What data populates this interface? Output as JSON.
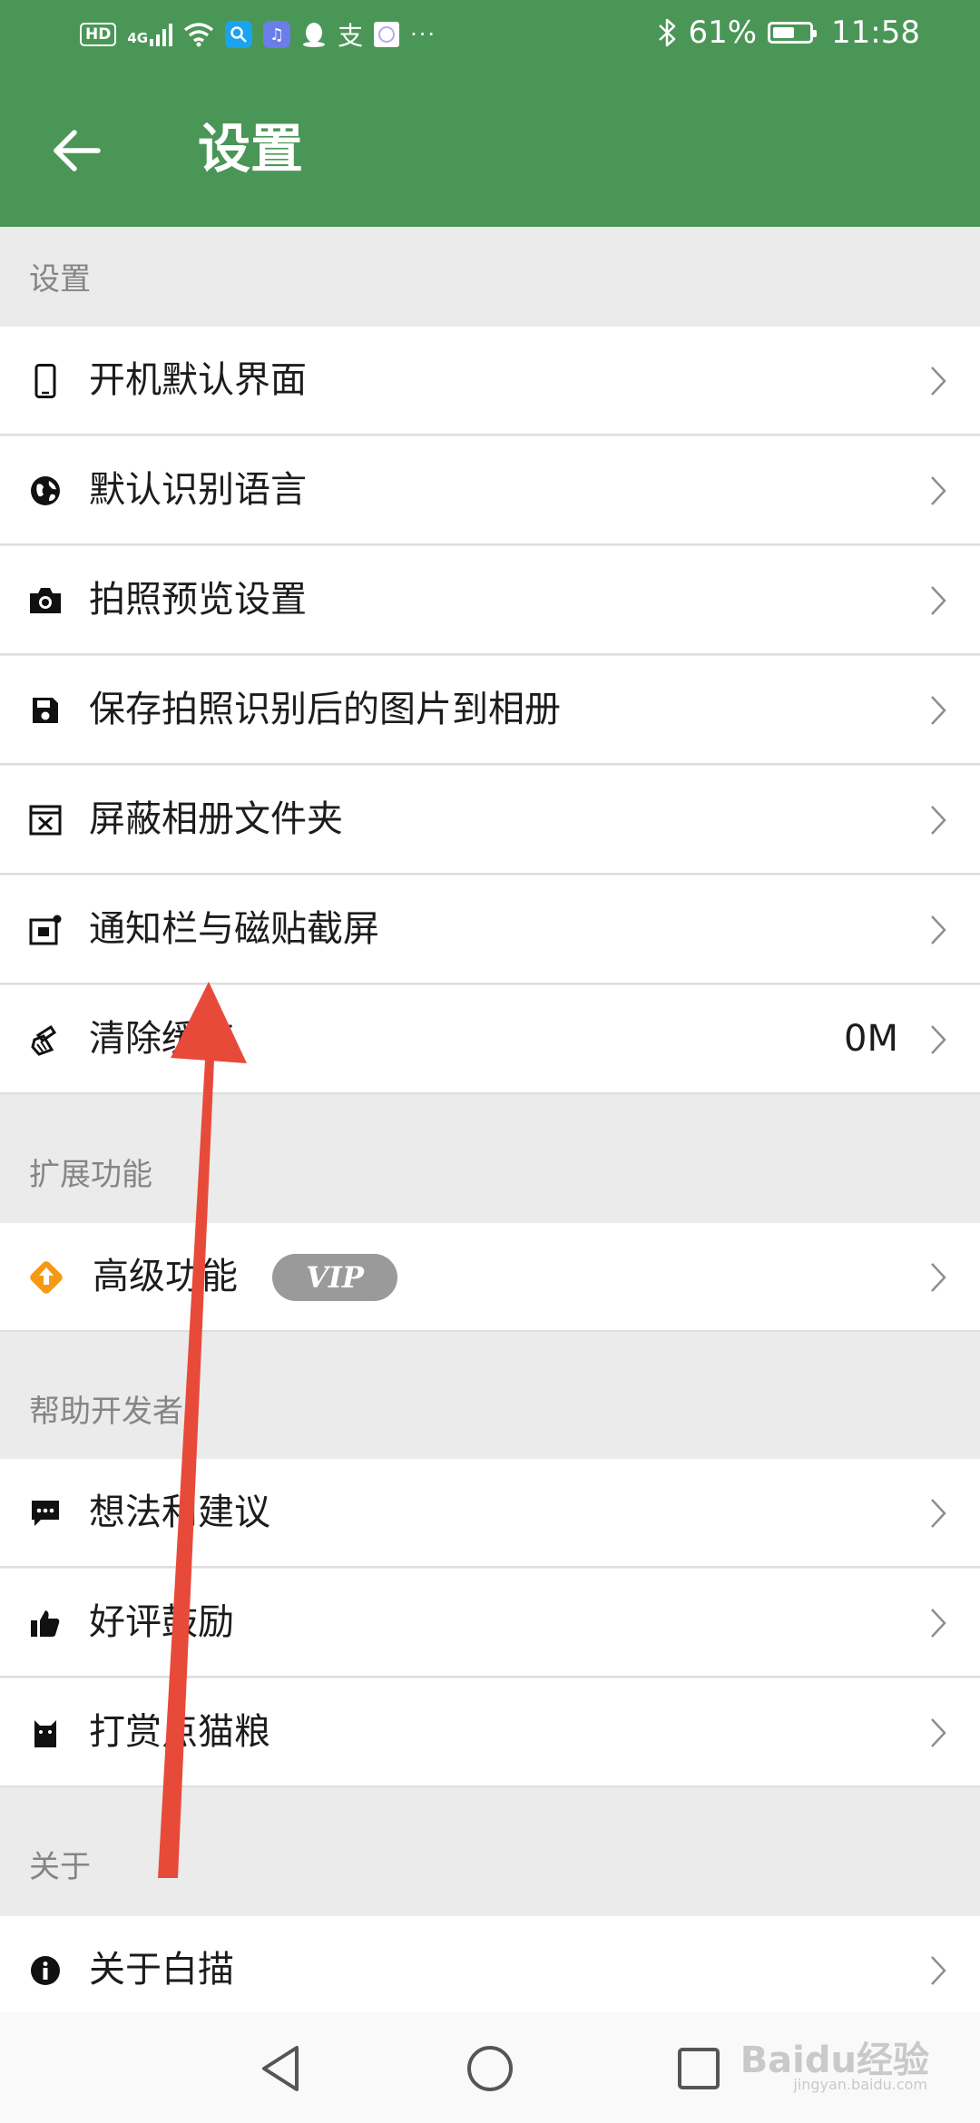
{
  "status_bar": {
    "hd": "HD",
    "network": "4G",
    "battery_percent": "61%",
    "battery_level": 0.61,
    "time": "11:58",
    "more": "···"
  },
  "app_bar": {
    "title": "设置",
    "back_icon": "arrow-left-icon"
  },
  "sections": [
    {
      "header": "设置",
      "items": [
        {
          "icon": "phone-icon",
          "label": "开机默认界面",
          "value": ""
        },
        {
          "icon": "globe-icon",
          "label": "默认识别语言",
          "value": ""
        },
        {
          "icon": "camera-icon",
          "label": "拍照预览设置",
          "value": ""
        },
        {
          "icon": "save-icon",
          "label": "保存拍照识别后的图片到相册",
          "value": ""
        },
        {
          "icon": "hidden-folder-icon",
          "label": "屏蔽相册文件夹",
          "value": ""
        },
        {
          "icon": "screenshot-icon",
          "label": "通知栏与磁贴截屏",
          "value": ""
        },
        {
          "icon": "broom-icon",
          "label": "清除缓存",
          "value": "0M"
        }
      ]
    },
    {
      "header": "扩展功能",
      "items": [
        {
          "icon": "premium-diamond-icon",
          "label": "高级功能",
          "badge": "VIP"
        }
      ]
    },
    {
      "header": "帮助开发者",
      "items": [
        {
          "icon": "feedback-icon",
          "label": "想法和建议"
        },
        {
          "icon": "thumbs-up-icon",
          "label": "好评鼓励"
        },
        {
          "icon": "cat-icon",
          "label": "打赏点猫粮"
        }
      ]
    },
    {
      "header": "关于",
      "items": [
        {
          "icon": "info-icon",
          "label": "关于白描"
        }
      ]
    }
  ],
  "nav_bar": {
    "back": "triangle-back-icon",
    "home": "circle-home-icon",
    "recents": "square-recents-icon"
  },
  "watermark": {
    "text": "Baidu经验",
    "sub": "jingyan.baidu.com"
  },
  "colors": {
    "primary": "#4a9657",
    "background": "#ebebeb",
    "annotation_arrow": "#e84a3a",
    "vip_badge": "#9a9a9a",
    "premium_icon": "#f59a12"
  }
}
